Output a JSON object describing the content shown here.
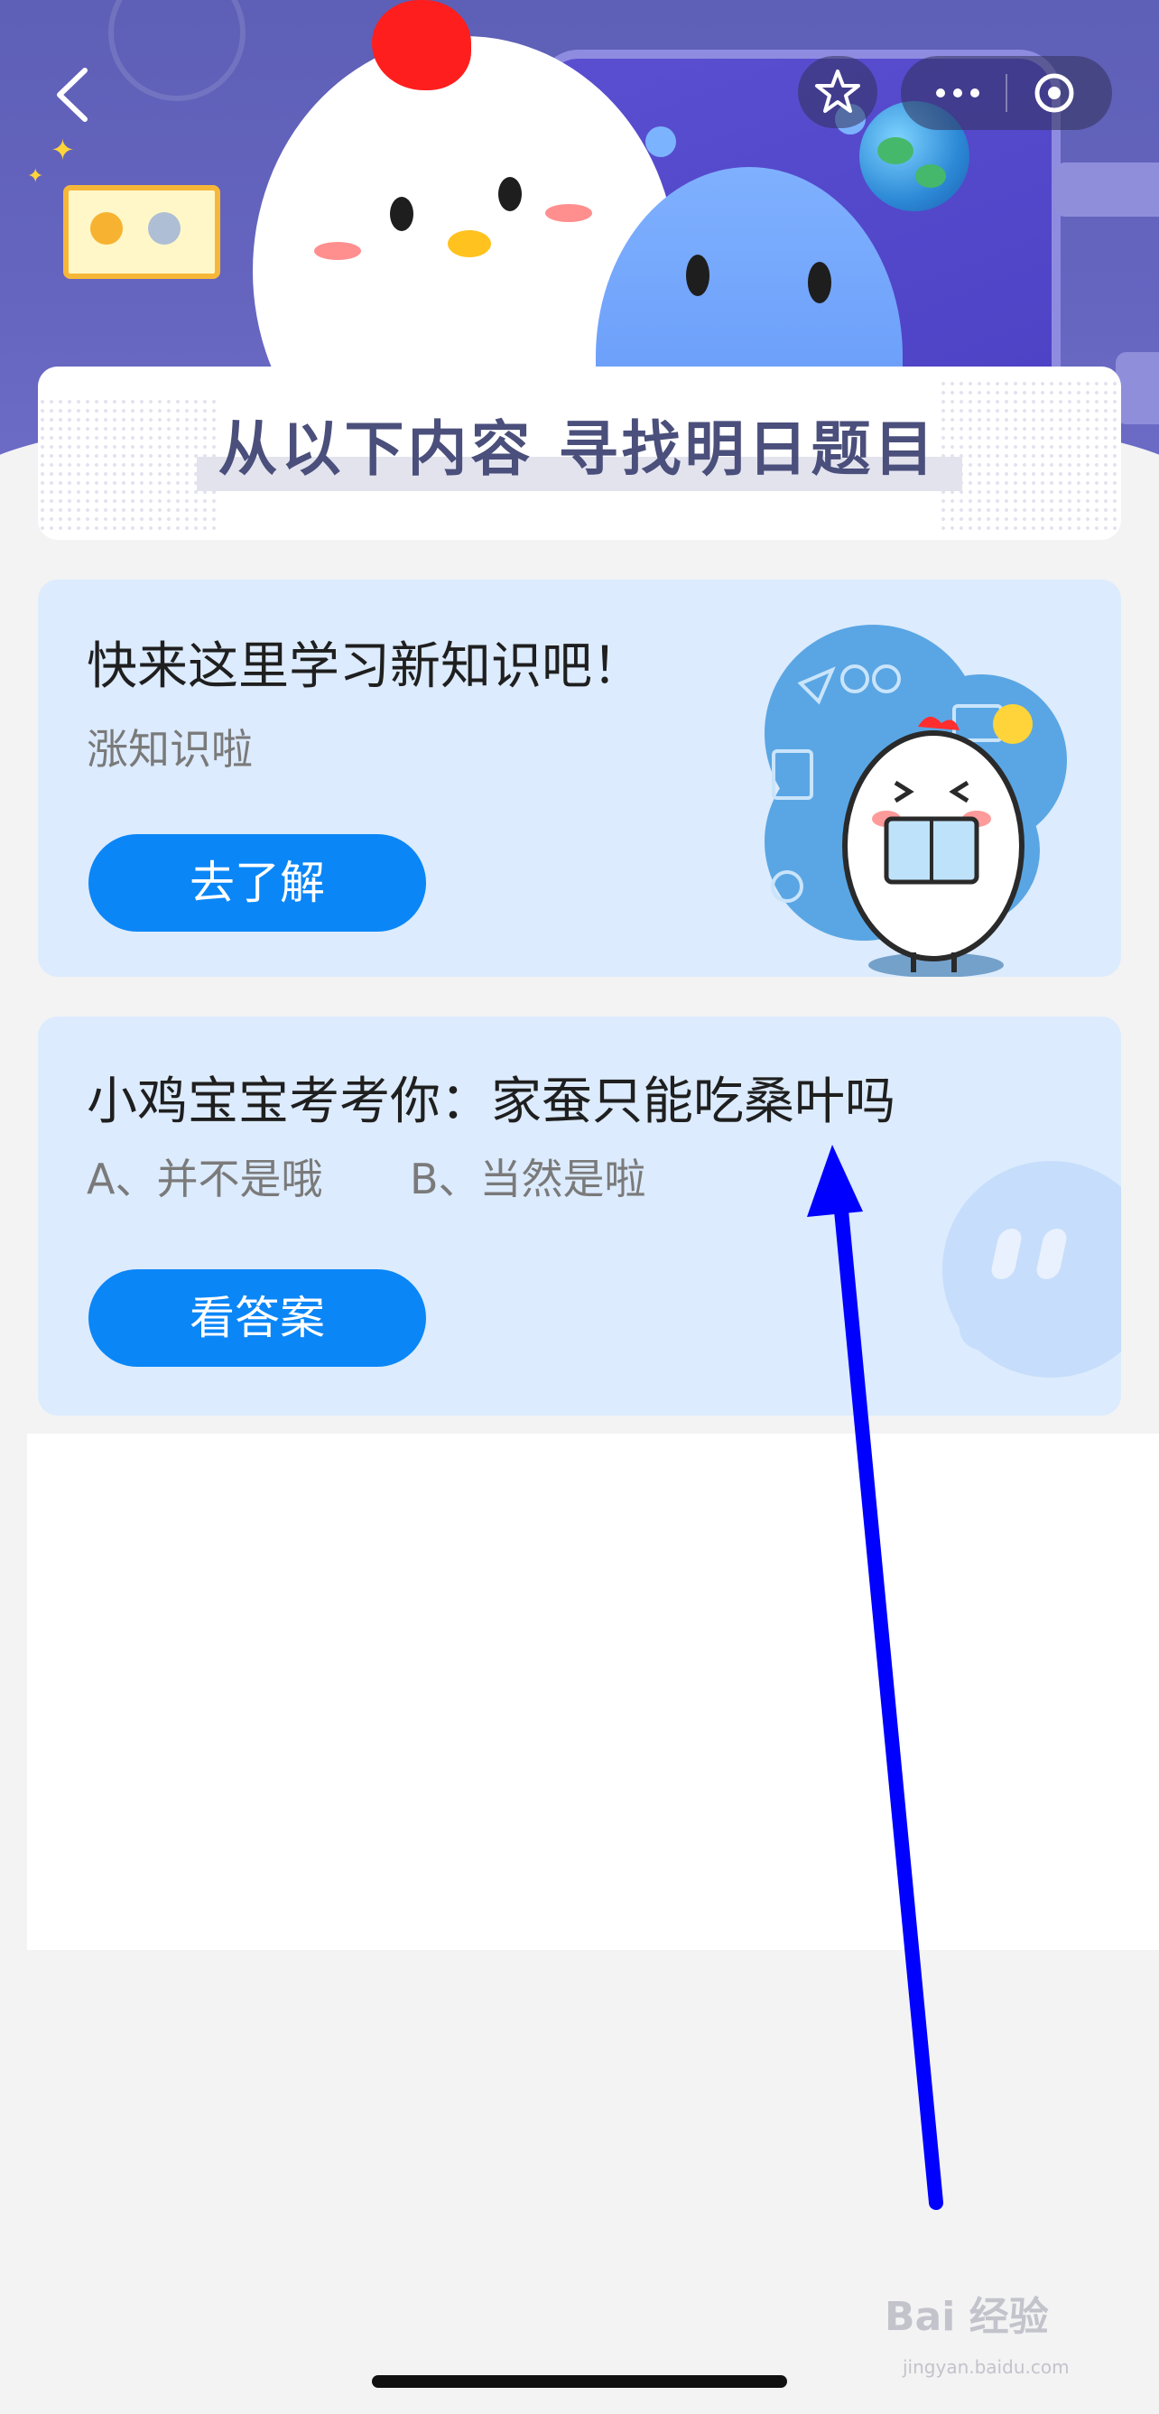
{
  "header": {
    "banner_title": "从以下内容  寻找明日题目"
  },
  "cards": [
    {
      "title": "快来这里学习新知识吧！",
      "subtitle": "涨知识啦",
      "button_label": "去了解"
    },
    {
      "question": "小鸡宝宝考考你：家蚕只能吃桑叶吗",
      "option_a": "A、并不是哦",
      "option_b": "B、当然是啦",
      "button_label": "看答案"
    }
  ],
  "watermark": {
    "brand": "Bai 经验",
    "url": "jingyan.baidu.com"
  },
  "colors": {
    "header_bg": "#6565c0",
    "card_bg": "#dcebfd",
    "button_bg": "#0a86f7",
    "annotation_arrow": "#0000ff"
  }
}
